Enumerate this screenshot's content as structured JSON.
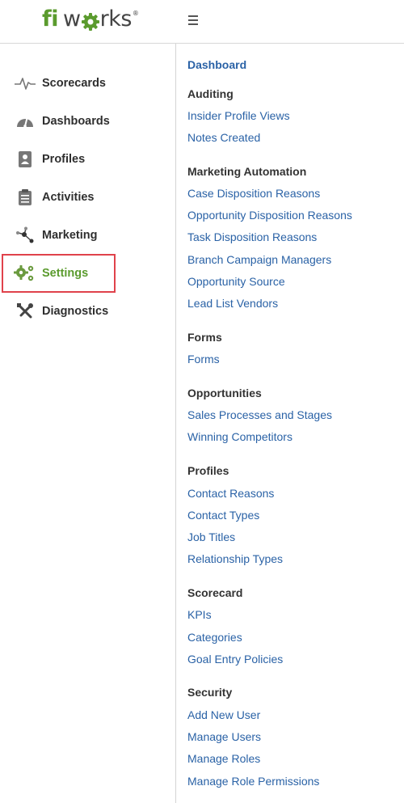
{
  "brand": {
    "logo_fi": "fi",
    "logo_w": "w",
    "logo_rks": "rks",
    "logo_reg": "®",
    "accent": "#5b9b2e"
  },
  "sidebar": {
    "items": [
      {
        "label": "Scorecards",
        "icon": "pulse-icon"
      },
      {
        "label": "Dashboards",
        "icon": "gauge-icon"
      },
      {
        "label": "Profiles",
        "icon": "contact-card-icon"
      },
      {
        "label": "Activities",
        "icon": "clipboard-icon"
      },
      {
        "label": "Marketing",
        "icon": "network-icon"
      },
      {
        "label": "Settings",
        "icon": "gears-icon",
        "active": true
      },
      {
        "label": "Diagnostics",
        "icon": "tools-icon"
      }
    ],
    "highlight_color": "#e0424b"
  },
  "content": {
    "dashboard_link": "Dashboard",
    "sections": [
      {
        "title": "Auditing",
        "links": [
          "Insider Profile Views",
          "Notes Created"
        ]
      },
      {
        "title": "Marketing Automation",
        "links": [
          "Case Disposition Reasons",
          "Opportunity Disposition Reasons",
          "Task Disposition Reasons",
          "Branch Campaign Managers",
          "Opportunity Source",
          "Lead List Vendors"
        ]
      },
      {
        "title": "Forms",
        "links": [
          "Forms"
        ]
      },
      {
        "title": "Opportunities",
        "links": [
          "Sales Processes and Stages",
          "Winning Competitors"
        ]
      },
      {
        "title": "Profiles",
        "links": [
          "Contact Reasons",
          "Contact Types",
          "Job Titles",
          "Relationship Types"
        ]
      },
      {
        "title": "Scorecard",
        "links": [
          "KPIs",
          "Categories",
          "Goal Entry Policies"
        ]
      },
      {
        "title": "Security",
        "links": [
          "Add New User",
          "Manage Users",
          "Manage Roles",
          "Manage Role Permissions"
        ]
      }
    ]
  }
}
